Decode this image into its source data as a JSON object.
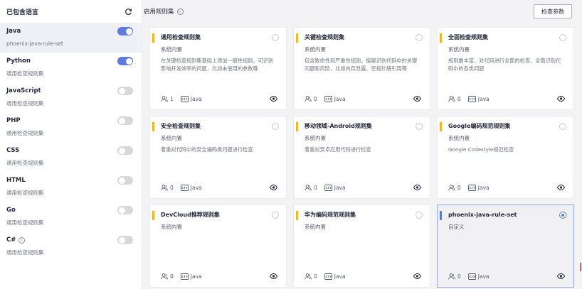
{
  "languages": {
    "title": "已包含语言",
    "items": [
      {
        "name": "Java",
        "sub": "phoenix-java-rule-set",
        "on": true,
        "active": true
      },
      {
        "name": "Python",
        "sub": "通用检查规则集",
        "on": true
      },
      {
        "name": "JavaScript",
        "sub": "通用检查规则集",
        "on": false
      },
      {
        "name": "PHP",
        "sub": "通用检查规则集",
        "on": false
      },
      {
        "name": "CSS",
        "sub": "通用检查规则集",
        "on": false
      },
      {
        "name": "HTML",
        "sub": "通用检查规则集",
        "on": false
      },
      {
        "name": "Go",
        "sub": "通用检查规则集",
        "on": false
      },
      {
        "name": "C#",
        "sub": "通用检查规则集",
        "on": false,
        "info": true
      }
    ]
  },
  "rules": {
    "title": "启用规则集",
    "check_params_label": "检查参数",
    "cards": [
      {
        "title": "通用检查规则集",
        "sub": "系统内置",
        "desc": "在关键检查规则集基础上添加一般性规则，可识别影响开发效率的问题，比如未使用的参数等",
        "users": "1",
        "lang": "Java"
      },
      {
        "title": "关键检查规则集",
        "sub": "系统内置",
        "desc": "包含致命性和严重性规则，能够识别代码中的关键问题和风险，比如内存泄露、空指针解引用等",
        "users": "0",
        "lang": "Java"
      },
      {
        "title": "全面检查规则集",
        "sub": "系统内置",
        "desc": "规则最丰富，对代码进行全面的检查，全面识别代码中的各类问题",
        "users": "0",
        "lang": "Java"
      },
      {
        "title": "安全检查规则集",
        "sub": "系统内置",
        "desc": "着重对代码中的安全编码类问题进行检查",
        "users": "0",
        "lang": "Java"
      },
      {
        "title": "移动领域-Android规则集",
        "sub": "系统内置",
        "desc": "着重对安卓应用代码进行检查",
        "users": "0",
        "lang": "Java"
      },
      {
        "title": "Google编码规范规则集",
        "sub": "系统内置",
        "desc": "Google Codestyle规范检查",
        "users": "0",
        "lang": "Java"
      },
      {
        "title": "DevCloud推荐规则集",
        "sub": "系统内置",
        "desc": "",
        "users": "0",
        "lang": "Java"
      },
      {
        "title": "华为编码规范规则集",
        "sub": "系统内置",
        "desc": "",
        "users": "0",
        "lang": "Java"
      },
      {
        "title": "phoenix-java-rule-set",
        "sub": "自定义",
        "desc": "",
        "users": "0",
        "lang": "Java",
        "selected": true
      }
    ]
  },
  "icons": {
    "refresh": "refresh-icon",
    "info": "info-icon",
    "users": "users-icon",
    "code": "code-icon",
    "eye": "eye-icon"
  },
  "colors": {
    "accent": "#5e7ce0",
    "card_bar": "#f6b520"
  }
}
